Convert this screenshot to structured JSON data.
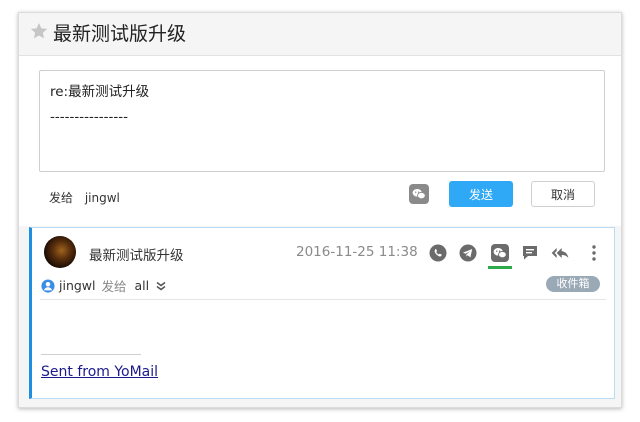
{
  "header": {
    "title": "最新测试版升级",
    "star_icon": "star-icon"
  },
  "reply": {
    "subject_line": "re:最新测试升级",
    "separator_line": "----------------",
    "sent_to_label": "发给",
    "recipient": "jingwl",
    "wechat_icon": "wechat-icon",
    "send_label": "发送",
    "cancel_label": "取消"
  },
  "message": {
    "subject": "最新测试版升级",
    "date": "2016-11-25 11:38",
    "actions": [
      "whatsapp-icon",
      "telegram-icon",
      "wechat-icon",
      "comment-icon",
      "reply-all-icon",
      "more-icon"
    ],
    "sender": "jingwl",
    "sent_to_label": "发给",
    "recipients": "all",
    "folder_badge": "收件箱",
    "signature": "Sent from YoMail"
  },
  "colors": {
    "accent_blue": "#2fa8f5",
    "panel_border_blue": "#1e8fe0",
    "active_green": "#2eaa4a",
    "badge_gray": "#9aa9b6"
  }
}
